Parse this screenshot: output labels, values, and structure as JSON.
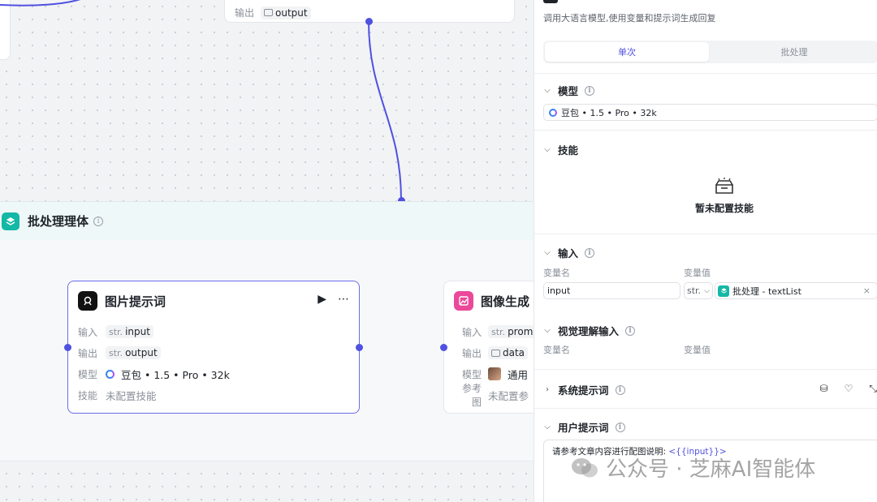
{
  "canvas": {
    "top_node": {
      "output_label": "输出",
      "output_chip": "output"
    },
    "batch": {
      "title": "批处理理体"
    },
    "node_prompt": {
      "title": "图片提示词",
      "rows": [
        {
          "label": "输入",
          "prefix": "str.",
          "value": "input"
        },
        {
          "label": "输出",
          "prefix": "str.",
          "value": "output"
        },
        {
          "label": "模型",
          "value": "豆包 • 1.5 • Pro • 32k"
        },
        {
          "label": "技能",
          "value": "未配置技能"
        }
      ]
    },
    "node_image": {
      "title": "图像生成",
      "rows": [
        {
          "label": "输入",
          "prefix": "str.",
          "value": "promp"
        },
        {
          "label": "输出",
          "value": "data"
        },
        {
          "label": "模型",
          "value": "通用"
        },
        {
          "label": "参考图",
          "value": "未配置参"
        }
      ]
    },
    "colors": {
      "edge": "#4f51e0",
      "selected_border": "#6a6ce8",
      "batch_icon": "#14b8a6",
      "image_icon": "#ec4899"
    }
  },
  "panel": {
    "description": "调用大语言模型,使用变量和提示词生成回复",
    "tabs": [
      {
        "label": "单次",
        "active": true
      },
      {
        "label": "批处理",
        "active": false
      }
    ],
    "model": {
      "title": "模型",
      "value": "豆包 • 1.5 • Pro • 32k"
    },
    "skills": {
      "title": "技能",
      "empty": "暂未配置技能"
    },
    "input": {
      "title": "输入",
      "col_name": "变量名",
      "col_value": "变量值",
      "name_value": "input",
      "type_value": "str.",
      "ref_value": "批处理 - textList"
    },
    "vision": {
      "title": "视觉理解输入",
      "col_name": "变量名",
      "col_value": "变量值"
    },
    "system_prompt": {
      "title": "系统提示词"
    },
    "user_prompt": {
      "title": "用户提示词",
      "text": "请参考文章内容进行配图说明: ",
      "variable": "<{{input}}>"
    }
  },
  "watermark": {
    "text": "公众号 · 芝麻AI智能体"
  }
}
